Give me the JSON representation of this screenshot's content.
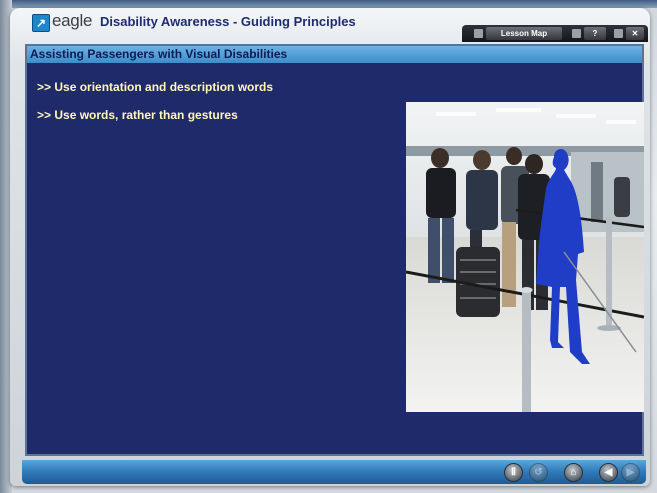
{
  "app": {
    "logo_text": "eagle",
    "course_title": "Disability Awareness - Guiding Principles"
  },
  "toolbar": {
    "lesson_map": "Lesson Map",
    "help": "?",
    "close": "✕"
  },
  "slide": {
    "title": "Assisting Passengers with Visual Disabilities",
    "bullets": [
      ">> Use orientation and description words",
      ">> Use words, rather than gestures"
    ]
  },
  "footer": {
    "nav_icons": [
      "pause-icon",
      "replay-icon",
      "home-icon",
      "back-icon",
      "next-icon"
    ]
  }
}
